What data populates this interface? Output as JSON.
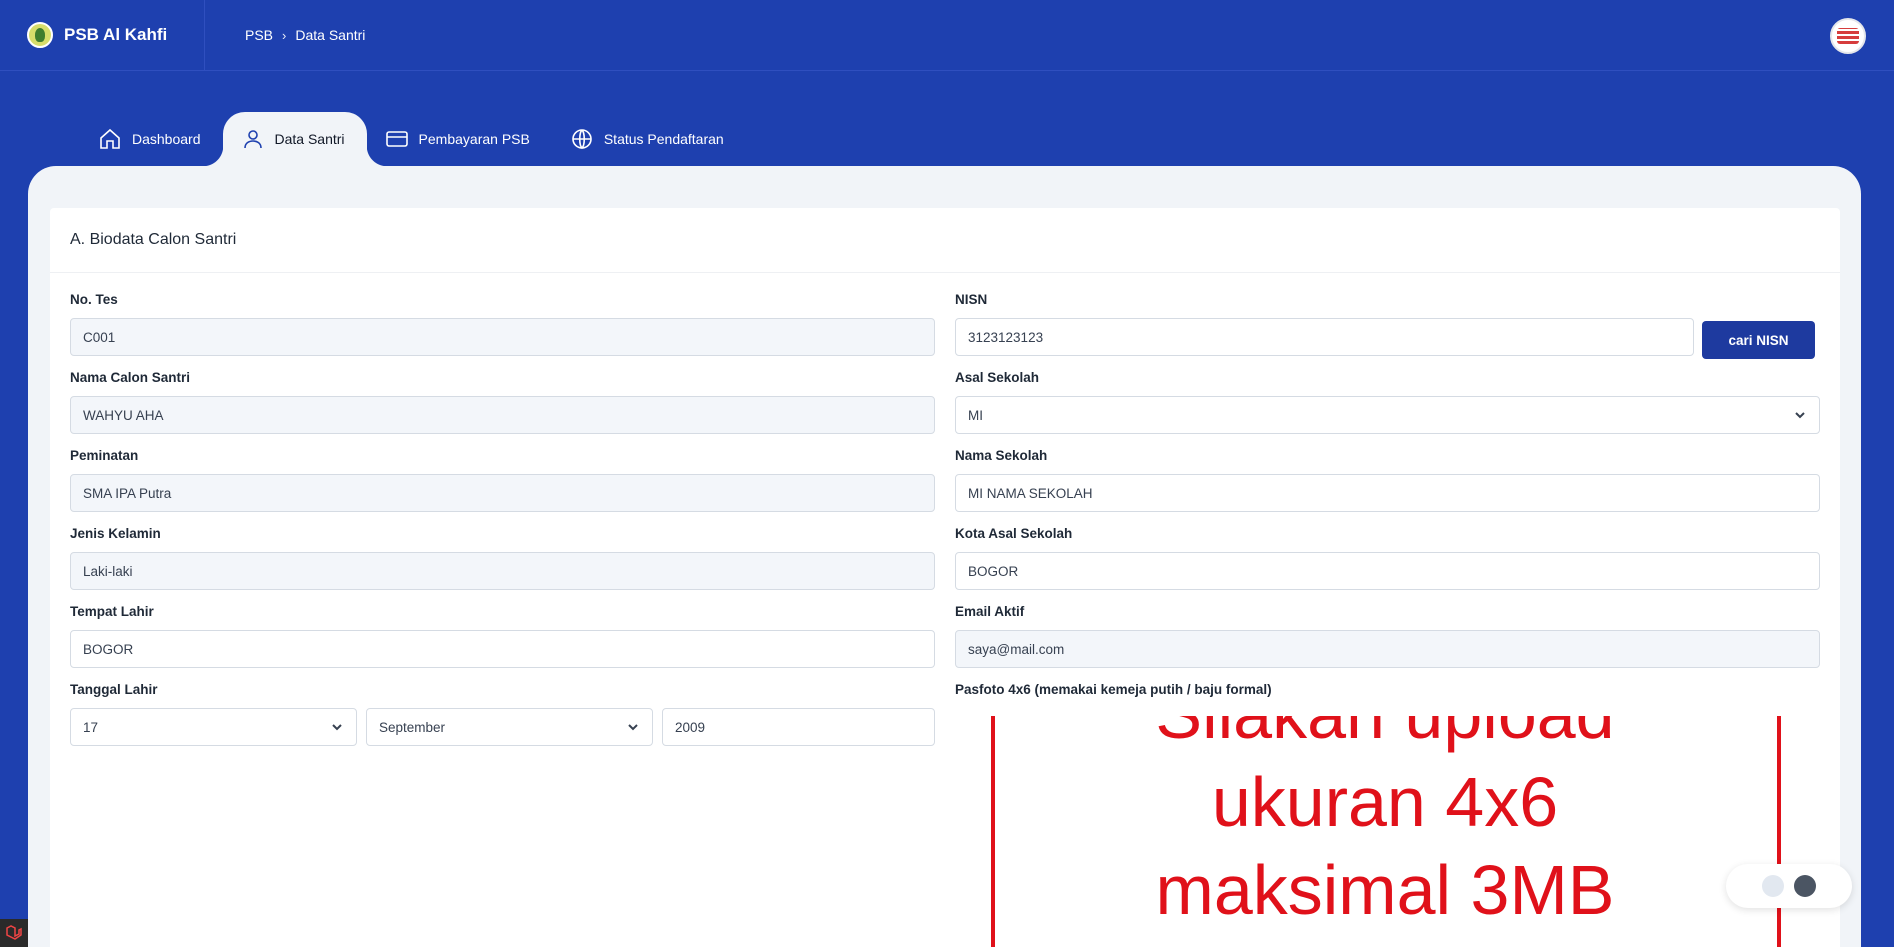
{
  "app": {
    "brand": "PSB Al Kahfi"
  },
  "breadcrumb": {
    "root": "PSB",
    "current": "Data Santri"
  },
  "tabs": [
    {
      "label": "Dashboard",
      "icon": "home-icon"
    },
    {
      "label": "Data Santri",
      "icon": "user-icon",
      "active": true
    },
    {
      "label": "Pembayaran PSB",
      "icon": "credit-card-icon"
    },
    {
      "label": "Status Pendaftaran",
      "icon": "globe-icon"
    }
  ],
  "section": {
    "title": "A. Biodata Calon Santri"
  },
  "left": {
    "no_tes": {
      "label": "No. Tes",
      "value": "C001"
    },
    "nama": {
      "label": "Nama Calon Santri",
      "value": "WAHYU AHA"
    },
    "peminatan": {
      "label": "Peminatan",
      "value": "SMA IPA Putra"
    },
    "jenis_kelamin": {
      "label": "Jenis Kelamin",
      "value": "Laki-laki"
    },
    "tempat_lahir": {
      "label": "Tempat Lahir",
      "value": "BOGOR"
    },
    "tanggal_lahir": {
      "label": "Tanggal Lahir",
      "day": "17",
      "month": "September",
      "year": "2009"
    }
  },
  "right": {
    "nisn": {
      "label": "NISN",
      "value": "3123123123",
      "button": "cari NISN"
    },
    "asal_sekolah": {
      "label": "Asal Sekolah",
      "value": "MI"
    },
    "nama_sekolah": {
      "label": "Nama Sekolah",
      "value": "MI NAMA SEKOLAH"
    },
    "kota_asal": {
      "label": "Kota Asal Sekolah",
      "value": "BOGOR"
    },
    "email": {
      "label": "Email Aktif",
      "value": "saya@mail.com"
    },
    "pasfoto": {
      "label": "Pasfoto 4x6 (memakai kemeja putih / baju formal)",
      "placeholder_lines": [
        "Silakan upload",
        "ukuran 4x6",
        "maksimal 3MB"
      ]
    }
  },
  "colors": {
    "primary": "#1e40af",
    "button": "#1e3a9f",
    "panel": "#f1f4f8",
    "placeholder_red": "#e0111a"
  }
}
